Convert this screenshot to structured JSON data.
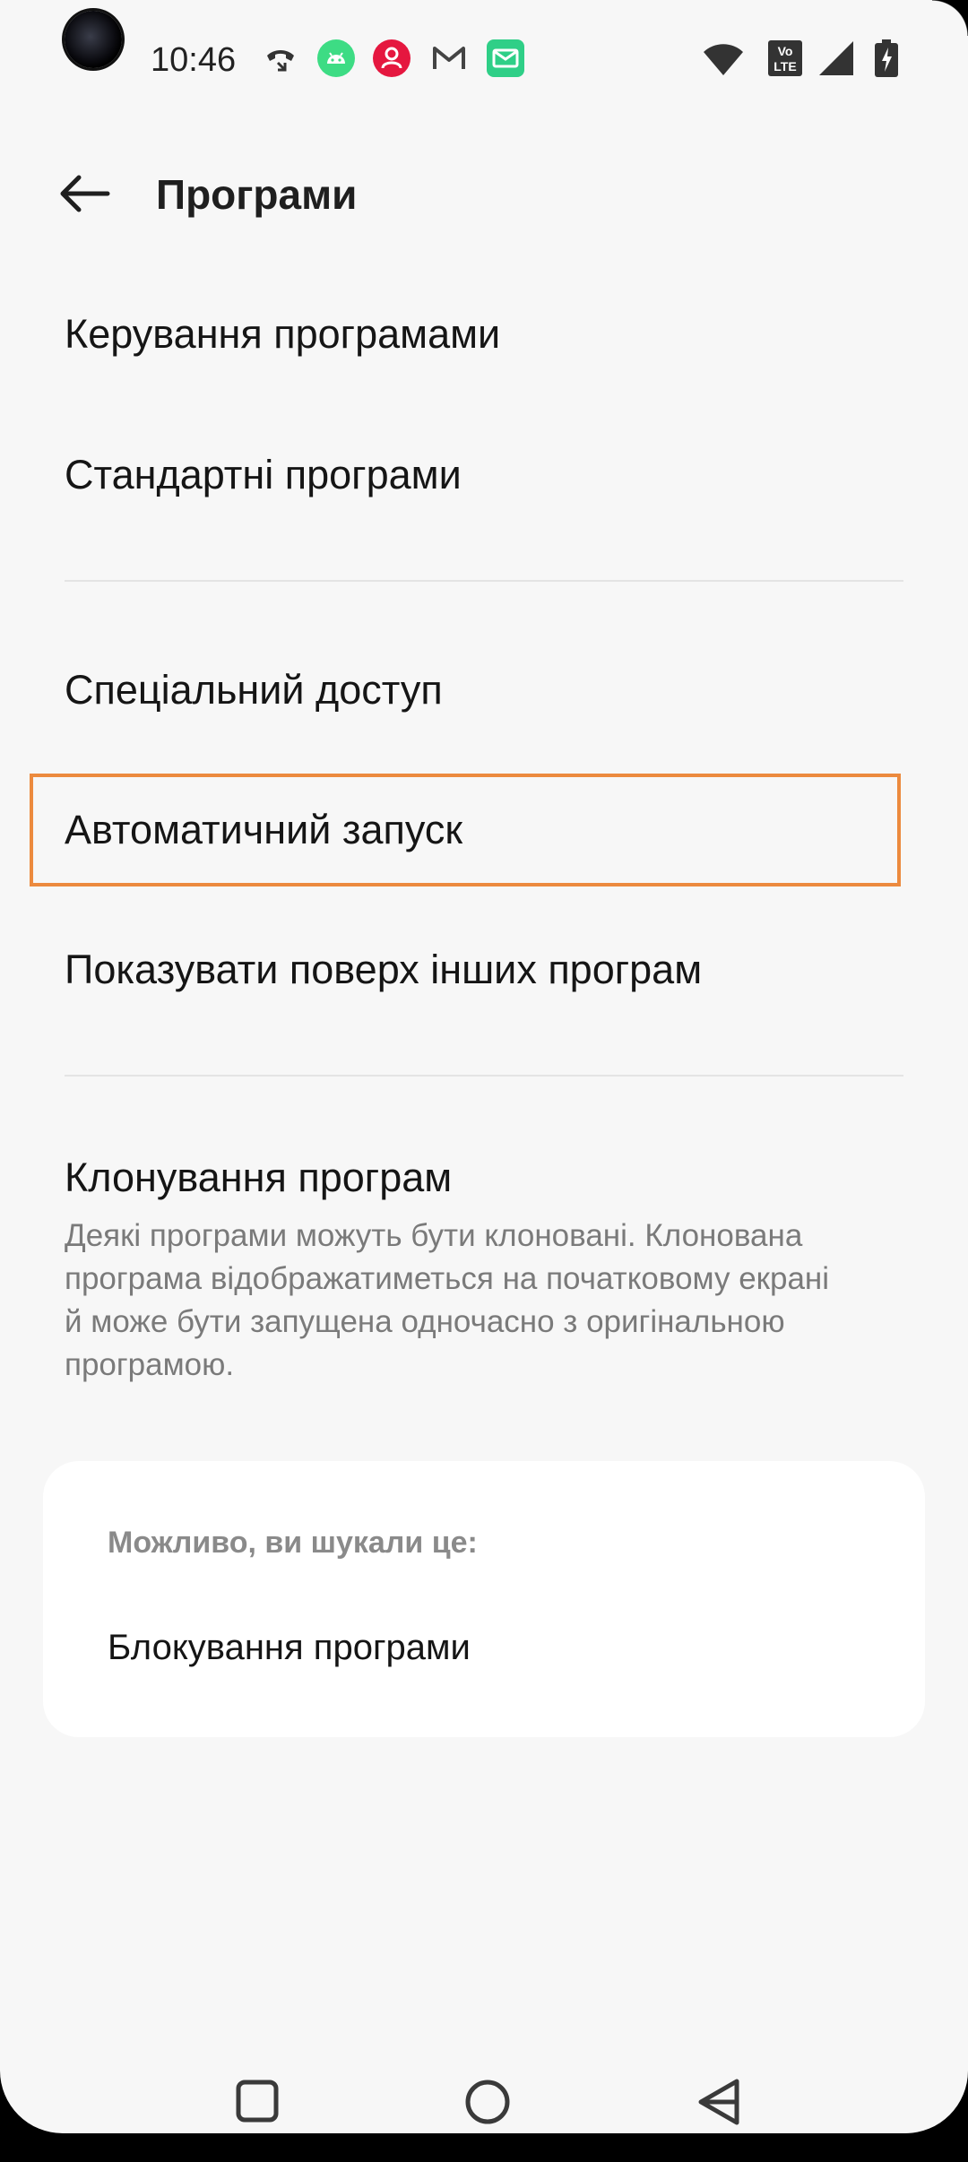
{
  "status_bar": {
    "time": "10:46",
    "left_icons": [
      "call-icon",
      "android-icon",
      "user-icon",
      "gmail-icon",
      "mail-icon"
    ],
    "right_icons": [
      "wifi-icon",
      "volte-icon",
      "signal-icon",
      "battery-icon"
    ],
    "volte_text_top": "Vo",
    "volte_text_bottom": "LTE"
  },
  "header": {
    "title": "Програми"
  },
  "menu": {
    "group1": [
      "Керування програмами",
      "Стандартні програми"
    ],
    "group2": [
      "Спеціальний доступ",
      "Автоматичний запуск",
      "Показувати поверх інших програм"
    ],
    "clone": {
      "title": "Клонування програм",
      "description_lines": [
        "Деякі програми можуть бути клоновані. Клонована",
        "програма відображатиметься на початковому екрані",
        "й може бути запущена одночасно з оригінальною",
        "програмою."
      ]
    }
  },
  "suggestions": {
    "label": "Можливо, ви шукали це:",
    "items": [
      "Блокування програми"
    ]
  },
  "colors": {
    "highlight": "#ec8a3e",
    "android_green": "#3ddc84",
    "user_red": "#e5173f",
    "mail_green": "#2fcf87"
  },
  "navigation": [
    "recents-icon",
    "home-icon",
    "back-icon"
  ]
}
